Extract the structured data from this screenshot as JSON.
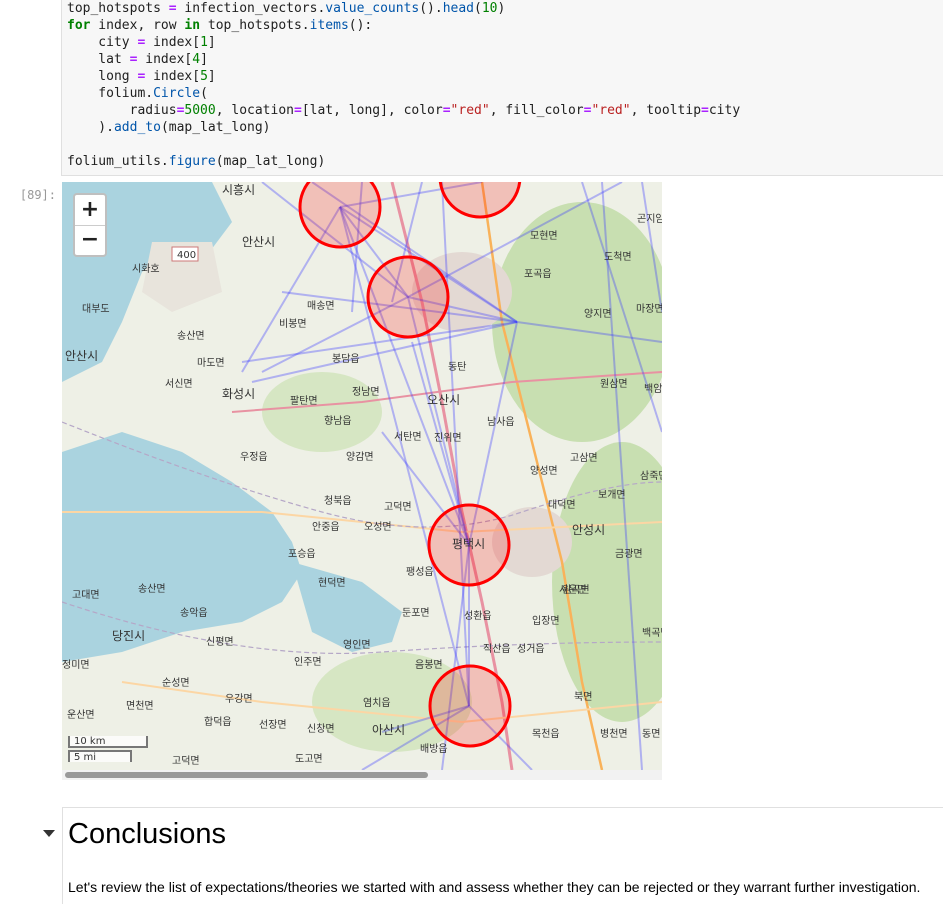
{
  "code_cell": {
    "lines": [
      "top_hotspots = infection_vectors.value_counts().head(10)",
      "for index, row in top_hotspots.items():",
      "    city = index[1]",
      "    lat = index[4]",
      "    long = index[5]",
      "    folium.Circle(",
      "        radius=5000, location=[lat, long], color=\"red\", fill_color=\"red\", tooltip=city",
      "    ).add_to(map_lat_long)",
      "",
      "folium_utils.figure(map_lat_long)"
    ]
  },
  "output_prompt": "[89]:",
  "map": {
    "zoom_in": "+",
    "zoom_out": "−",
    "scale_km": "10 km",
    "scale_mi": "5 mi",
    "road_badge": "400",
    "circle_color": "#ff0000",
    "line_color": "#3b3bff",
    "labels": [
      "시흥시",
      "안산시",
      "시화호",
      "대부도",
      "송산면",
      "마도면",
      "서신면",
      "화성시",
      "안산시",
      "비봉면",
      "매송면",
      "봉담읍",
      "정남면",
      "팔탄면",
      "향남읍",
      "양감면",
      "우정읍",
      "곤지암",
      "모현면",
      "도척면",
      "포곡읍",
      "양지면",
      "마장면",
      "원삼면",
      "백암",
      "동탄",
      "오산시",
      "남사읍",
      "서탄면",
      "진위면",
      "고삼면",
      "양성면",
      "삼죽면",
      "보개면",
      "대덕면",
      "안성시",
      "금광면",
      "원곡면",
      "평택시",
      "청북읍",
      "고덕면",
      "오성면",
      "안중읍",
      "포승읍",
      "현덕면",
      "팽성읍",
      "고대면",
      "송산면",
      "송악읍",
      "당진시",
      "신평면",
      "인주면",
      "영인면",
      "둔포면",
      "성환읍",
      "입장면",
      "서운면",
      "백곡면",
      "직산읍",
      "성거읍",
      "음봉면",
      "북면",
      "병천면",
      "동면",
      "목천읍",
      "배방읍",
      "아산시",
      "신창면",
      "선장면",
      "염치읍",
      "도고면",
      "합덕읍",
      "우강면",
      "면천면",
      "순성면",
      "운산면",
      "정미면",
      "고덕면"
    ]
  },
  "markdown_cell": {
    "heading": "Conclusions",
    "paragraph": "Let's review the list of expectations/theories we started with and assess whether they can be rejected or they warrant further investigation."
  }
}
